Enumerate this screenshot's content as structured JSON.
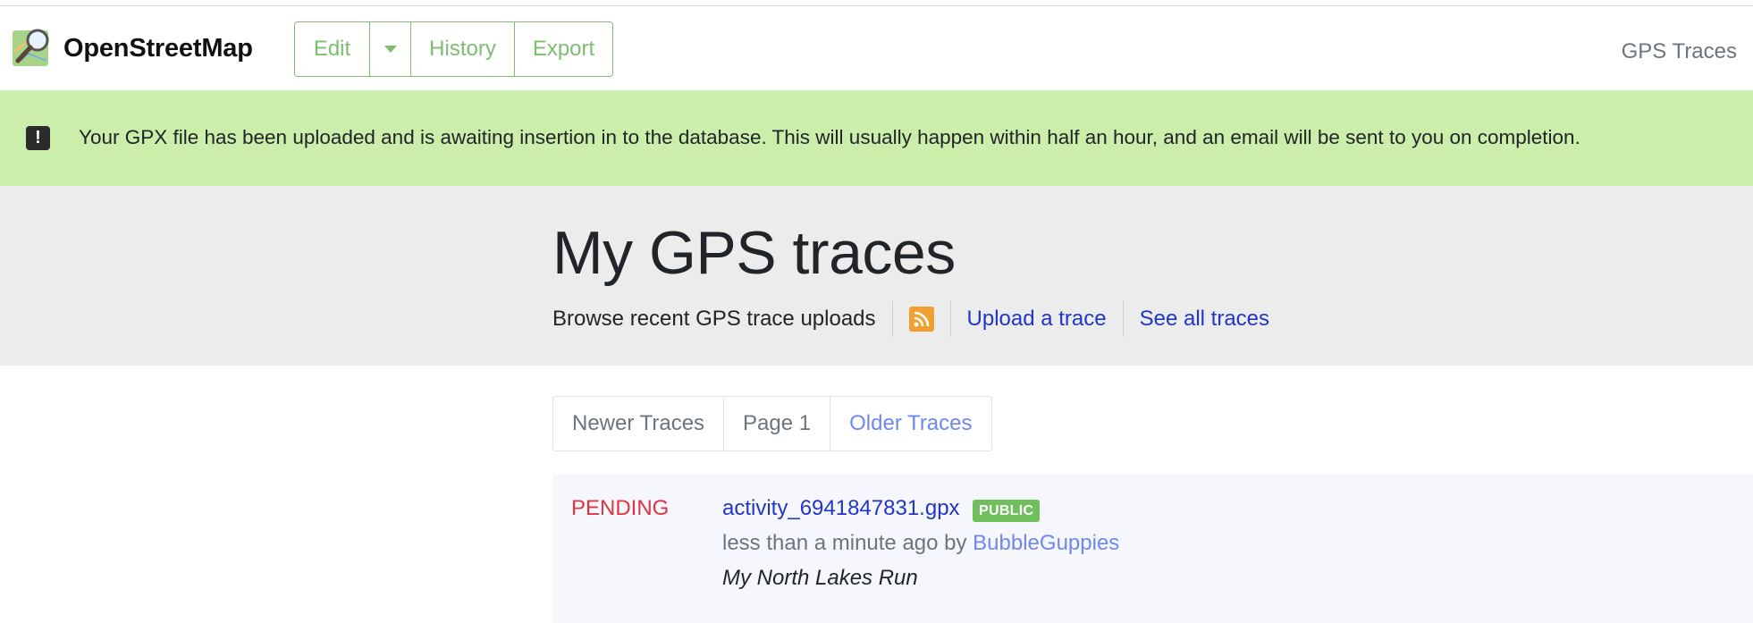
{
  "header": {
    "brand": "OpenStreetMap",
    "edit_label": "Edit",
    "history_label": "History",
    "export_label": "Export",
    "nav_right": "GPS Traces"
  },
  "flash": {
    "icon": "exclamation-icon",
    "message": "Your GPX file has been uploaded and is awaiting insertion in to the database. This will usually happen within half an hour, and an email will be sent to you on completion."
  },
  "content": {
    "title": "My GPS traces",
    "browse_text": "Browse recent GPS trace uploads",
    "rss_icon": "rss-icon",
    "upload_link": "Upload a trace",
    "see_all_link": "See all traces"
  },
  "pagination": {
    "newer": "Newer Traces",
    "page": "Page 1",
    "older": "Older Traces"
  },
  "traces": [
    {
      "status": "PENDING",
      "filename": "activity_6941847831.gpx",
      "visibility": "PUBLIC",
      "time_text": "less than a minute ago by ",
      "user": "BubbleGuppies",
      "description": "My North Lakes Run"
    }
  ],
  "colors": {
    "brand_green": "#7ebc6f",
    "flash_bg": "#cbeeaa",
    "link_blue": "#2036c6",
    "pending_red": "#dc3545",
    "badge_green": "#6fbf5c",
    "rss_orange": "#f0a030"
  }
}
